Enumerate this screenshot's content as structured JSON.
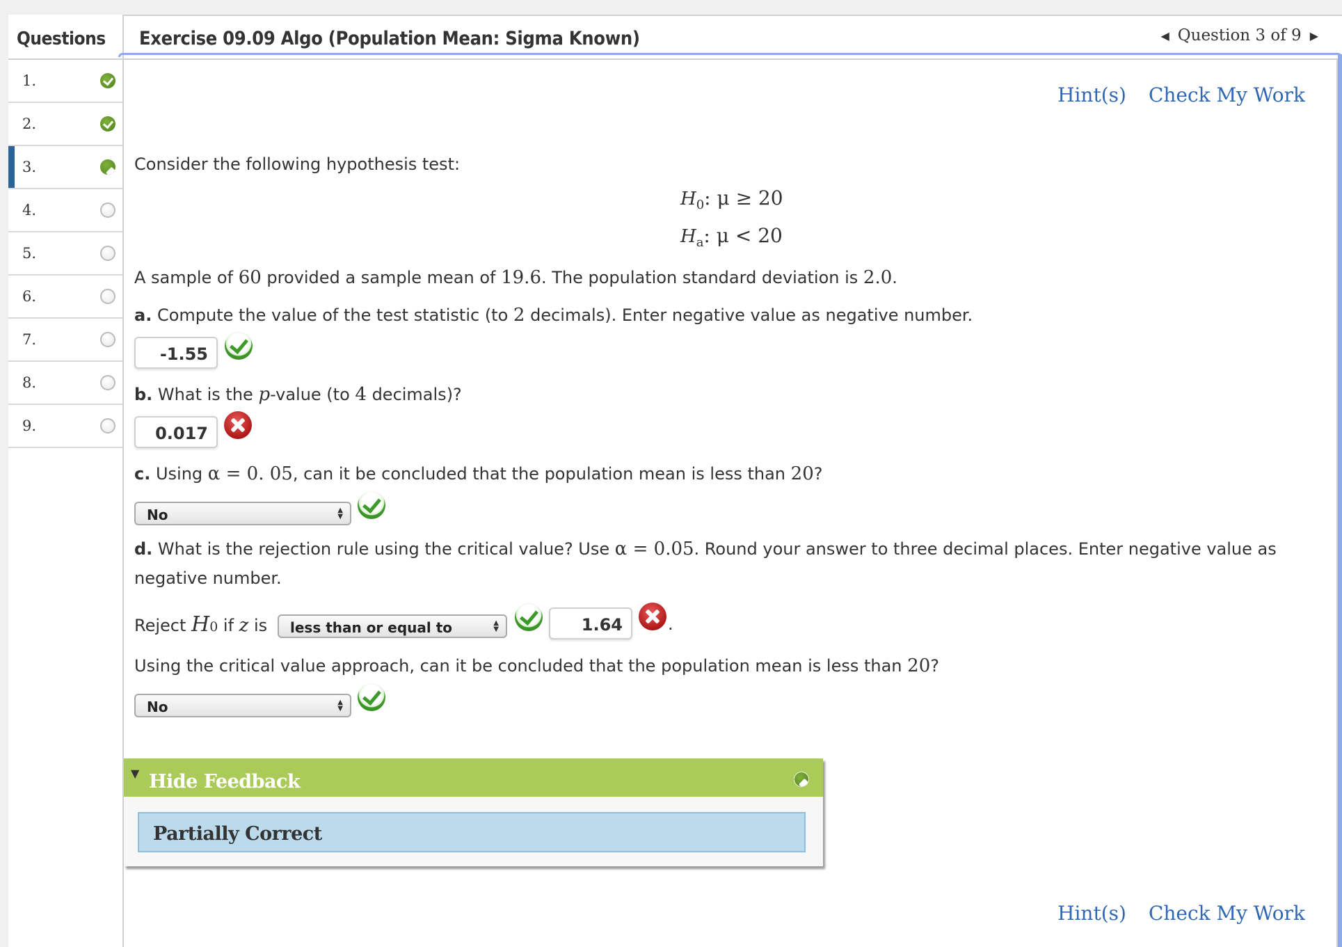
{
  "sidebar": {
    "title": "Questions",
    "items": [
      {
        "label": "1.",
        "status": "done"
      },
      {
        "label": "2.",
        "status": "done"
      },
      {
        "label": "3.",
        "status": "partial"
      },
      {
        "label": "4.",
        "status": "empty"
      },
      {
        "label": "5.",
        "status": "empty"
      },
      {
        "label": "6.",
        "status": "empty"
      },
      {
        "label": "7.",
        "status": "empty"
      },
      {
        "label": "8.",
        "status": "empty"
      },
      {
        "label": "9.",
        "status": "empty"
      }
    ],
    "active_index": 2
  },
  "header": {
    "title": "Exercise 09.09 Algo (Population Mean: Sigma Known)",
    "nav_label": "Question 3 of 9",
    "prev_icon": "triangle-left-icon",
    "next_icon": "triangle-right-icon"
  },
  "links": {
    "hints": "Hint(s)",
    "check": "Check My Work"
  },
  "question": {
    "intro": "Consider the following hypothesis test:",
    "h0": {
      "symbol": "H",
      "sub": "0",
      "rest": ": μ ≥ 20"
    },
    "ha": {
      "symbol": "H",
      "sub": "a",
      "rest": ": μ < 20"
    },
    "sample": {
      "t1": "A sample of ",
      "n": "60",
      "t2": " provided a sample mean of ",
      "mean": "19.6",
      "t3": ". The population standard deviation is ",
      "sd": "2.0",
      "t4": "."
    },
    "a": {
      "label": "a.",
      "t1": " Compute the value of the test statistic (to ",
      "num": "2",
      "t2": " decimals). Enter negative value as negative number.",
      "answer": "-1.55",
      "result": "correct"
    },
    "b": {
      "label": "b.",
      "t1": " What is the ",
      "var": "p",
      "t2": "-value (to ",
      "num": "4",
      "t3": " decimals)?",
      "answer": "0.017",
      "result": "incorrect"
    },
    "c": {
      "label": "c.",
      "t1": " Using ",
      "alpha": "α = 0. 05",
      "t2": ", can it be concluded that the population mean is less than ",
      "num": "20",
      "t3": "?",
      "selected": "No",
      "result": "correct"
    },
    "d": {
      "label": "d.",
      "t1": " What is the rejection rule using the critical value? Use ",
      "alpha": "α = 0.05",
      "t2": ". Round your answer to three decimal places. Enter negative value as",
      "t3": "negative number.",
      "reject_t1": "Reject ",
      "reject_h": "H",
      "reject_sub": "0",
      "reject_t2": " if ",
      "reject_z": "z",
      "reject_t3": " is",
      "selected": "less than or equal to",
      "select_result": "correct",
      "answer": "1.64",
      "answer_result": "incorrect",
      "period": "."
    },
    "e": {
      "t1": "Using the critical value approach, can it be concluded that the population mean is less than ",
      "num": "20",
      "t2": "?",
      "selected": "No",
      "result": "correct"
    }
  },
  "feedback": {
    "toggle_label": "Hide Feedback",
    "result_text": "Partially Correct"
  },
  "colors": {
    "link": "#2f68b4",
    "feedback_header": "#abcb58",
    "feedback_body": "#bbdaeb",
    "active_marker": "#2a6497",
    "focus_border": "#8eaaec"
  }
}
